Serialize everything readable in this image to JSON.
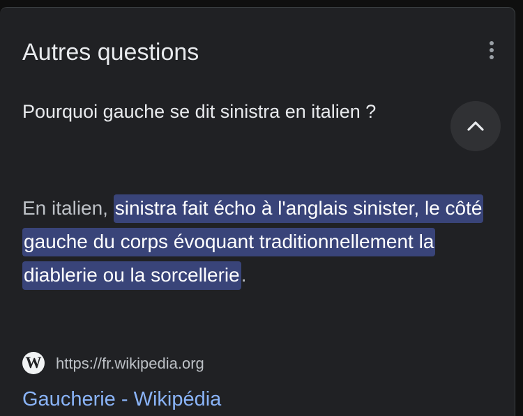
{
  "section": {
    "title": "Autres questions",
    "menu_icon": "more-vert-icon"
  },
  "question": {
    "text": "Pourquoi gauche se dit sinistra en italien ?",
    "toggle_icon": "chevron-up-icon",
    "expanded": true
  },
  "answer": {
    "prefix": "En italien, ",
    "highlight": "sinistra fait écho à l'anglais sinister, le côté gauche du corps évoquant traditionnellement la diablerie ou la sorcellerie",
    "suffix": "."
  },
  "source": {
    "logo_letter": "W",
    "logo_icon": "wikipedia-icon",
    "url": "https://fr.wikipedia.org",
    "link_title": "Gaucherie - Wikipédia"
  },
  "colors": {
    "background": "#202124",
    "highlight_bg": "#394479",
    "link": "#8ab4f8"
  }
}
